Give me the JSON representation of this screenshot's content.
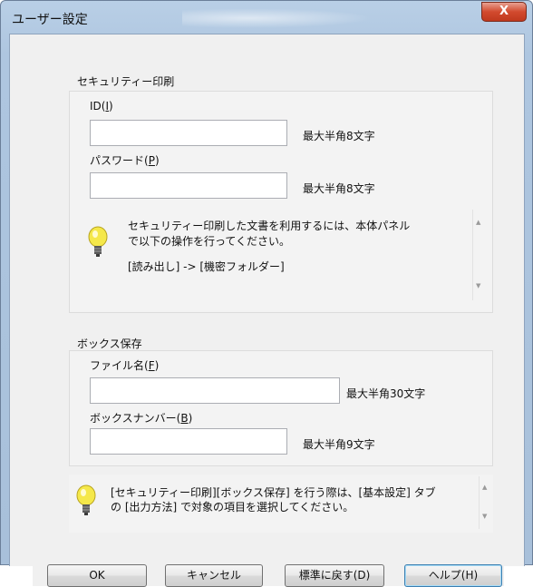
{
  "window": {
    "title": "ユーザー設定",
    "close_glyph": "X"
  },
  "security": {
    "group_label": "セキュリティー印刷",
    "id_label": "ID(",
    "id_mnemonic": "I",
    "id_label_end": ")",
    "id_value": "",
    "id_note": "最大半角8文字",
    "password_label": "パスワード(",
    "password_mnemonic": "P",
    "password_label_end": ")",
    "password_value": "",
    "password_note": "最大半角8文字",
    "hint_line1": "セキュリティー印刷した文書を利用するには、本体パネル",
    "hint_line2": "で以下の操作を行ってください。",
    "hint_line3": "[読み出し] -> [機密フォルダー]"
  },
  "box": {
    "group_label": "ボックス保存",
    "filename_label": "ファイル名(",
    "filename_mnemonic": "F",
    "filename_label_end": ")",
    "filename_value": "",
    "filename_note": "最大半角30文字",
    "boxnumber_label": "ボックスナンバー(",
    "boxnumber_mnemonic": "B",
    "boxnumber_label_end": ")",
    "boxnumber_value": "",
    "boxnumber_note": "最大半角9文字"
  },
  "bottom_hint": {
    "line1": "[セキュリティー印刷][ボックス保存] を行う際は、[基本設定] タブ",
    "line2": "の [出力方法] で対象の項目を選択してください。"
  },
  "buttons": {
    "ok": "OK",
    "cancel": "キャンセル",
    "reset": "標準に戻す(D)",
    "help": "ヘルプ(H)"
  },
  "icons": {
    "hint": "lightbulb-icon",
    "scroll_up": "chevron-up-icon",
    "scroll_down": "chevron-down-icon"
  },
  "colors": {
    "accent": "#3c7fb1",
    "bulb": "#f5e84a"
  }
}
